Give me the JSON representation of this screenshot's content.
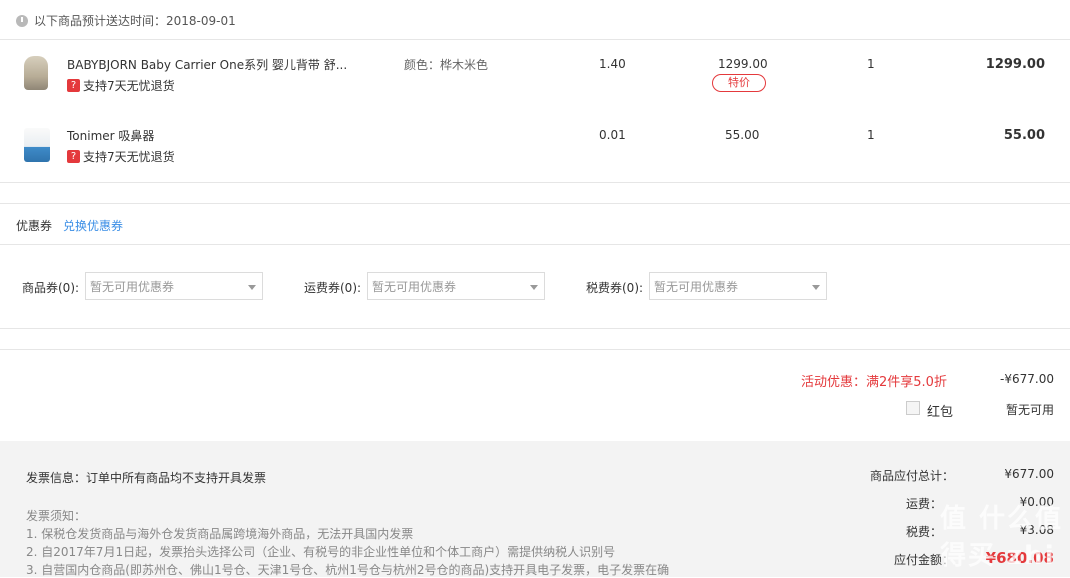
{
  "delivery": {
    "text": "以下商品预计送达时间：2018-09-01"
  },
  "items": [
    {
      "name": "BABYBJORN Baby Carrier One系列 婴儿背带 舒...",
      "badge": "支持7天无忧退货",
      "badge_icon": "?",
      "spec": "颜色：桦木米色",
      "weight": "1.40",
      "price": "1299.00",
      "tag": "特价",
      "qty": "1",
      "subtotal": "1299.00"
    },
    {
      "name": "Tonimer 吸鼻器",
      "badge": "支持7天无忧退货",
      "badge_icon": "?",
      "weight": "0.01",
      "price": "55.00",
      "qty": "1",
      "subtotal": "55.00"
    }
  ],
  "coupon": {
    "title": "优惠券",
    "exchange_link": "兑换优惠券",
    "selects": [
      {
        "label": "商品券(0):",
        "value": "暂无可用优惠券"
      },
      {
        "label": "运费券(0):",
        "value": "暂无可用优惠券"
      },
      {
        "label": "税费券(0):",
        "value": "暂无可用优惠券"
      }
    ]
  },
  "promotion": {
    "text": "活动优惠：满2件享5.0折",
    "amount": "-¥677.00"
  },
  "redpack": {
    "label": "红包",
    "status": "暂无可用"
  },
  "invoice": {
    "info": "发票信息：订单中所有商品均不支持开具发票",
    "notice_title": "发票须知：",
    "notices": [
      "1. 保税仓发货商品与海外仓发货商品属跨境海外商品，无法开具国内发票",
      "2. 自2017年7月1日起，发票抬头选择公司（企业、有税号的非企业性单位和个体工商户）需提供纳税人识别号",
      "3. 自营国内仓商品(即苏州仓、佛山1号仓、天津1号仓、杭州1号仓与杭州2号仓的商品)支持开具电子发票，电子发票在确"
    ]
  },
  "summary": {
    "goods_label": "商品应付总计：",
    "goods_value": "¥677.00",
    "shipping_label": "运费：",
    "shipping_value": "¥0.00",
    "tax_label": "税费：",
    "tax_value": "¥3.08",
    "payable_label": "应付金额：",
    "payable_value": "¥680.08"
  },
  "watermark": "值 什么值得买 zhi"
}
